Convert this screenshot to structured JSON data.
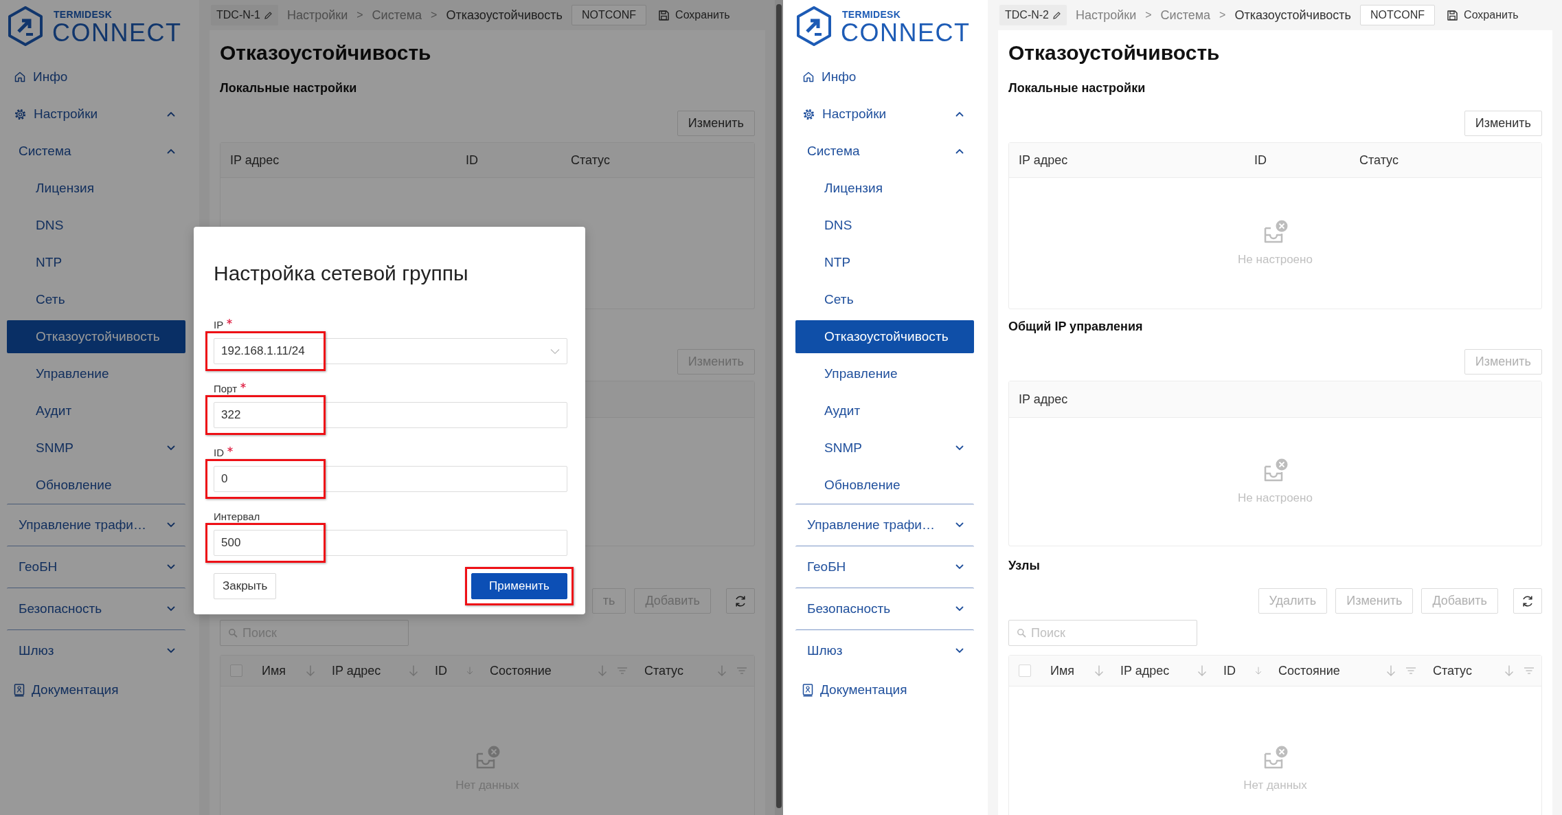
{
  "panes": [
    {
      "logo": {
        "brand": "TERMIDESK",
        "product": "CONNECT"
      },
      "node": "TDC-N-1",
      "breadcrumbs": [
        {
          "label": "Настройки",
          "separator": ">",
          "current": false
        },
        {
          "label": "Система",
          "separator": ">",
          "current": false
        },
        {
          "label": "Отказоустойчивость",
          "current": true
        }
      ],
      "mode": "NOTCONF",
      "save": "Сохранить",
      "sidebar": [
        {
          "kind": "home",
          "label": "Инфо",
          "selected": false
        },
        {
          "kind": "settings",
          "label": "Настройки",
          "selected": false,
          "expanded": true,
          "children": [
            {
              "kind": "group",
              "label": "Система",
              "selected": false,
              "expanded": true,
              "children": [
                {
                  "kind": "item",
                  "label": "Лицензия",
                  "selected": false
                },
                {
                  "kind": "item",
                  "label": "DNS",
                  "selected": false
                },
                {
                  "kind": "item",
                  "label": "NTP",
                  "selected": false
                },
                {
                  "kind": "item",
                  "label": "Сеть",
                  "selected": false
                },
                {
                  "kind": "item",
                  "label": "Отказоустойчивость",
                  "selected": true
                },
                {
                  "kind": "item",
                  "label": "Управление",
                  "selected": false
                },
                {
                  "kind": "item",
                  "label": "Аудит",
                  "selected": false
                },
                {
                  "kind": "group",
                  "label": "SNMP",
                  "selected": false,
                  "expanded": false
                },
                {
                  "kind": "item",
                  "label": "Обновление",
                  "selected": false
                }
              ]
            },
            {
              "kind": "group",
              "label": "Управление трафи…",
              "selected": false,
              "expanded": false
            },
            {
              "kind": "group",
              "label": "ГеоБН",
              "selected": false,
              "expanded": false
            },
            {
              "kind": "group",
              "label": "Безопасность",
              "selected": false,
              "expanded": false
            },
            {
              "kind": "group",
              "label": "Шлюз",
              "selected": false,
              "expanded": false
            }
          ]
        },
        {
          "kind": "docs",
          "label": "Документация",
          "selected": false
        }
      ],
      "page_title": "Отказоустойчивость",
      "sections": [
        {
          "title": "Локальные настройки",
          "buttons": [
            {
              "kind": "text",
              "label": "Изменить",
              "disabled": false
            }
          ],
          "table": {
            "columns": [
              {
                "label": "IP адрес"
              },
              {
                "label": "ID"
              },
              {
                "label": "Статус"
              }
            ]
          }
        },
        {
          "buttons": [
            {
              "kind": "text",
              "label": "Изменить",
              "disabled": true
            }
          ]
        },
        {
          "buttons": [
            {
              "kind": "text",
              "label": "ть",
              "disabled": true
            },
            {
              "kind": "text",
              "label": "Добавить",
              "disabled": true
            },
            {
              "kind": "refresh"
            }
          ],
          "search": {
            "placeholder": "Поиск"
          },
          "table": {
            "select_all": {
              "checked": false
            },
            "columns": [
              {
                "label": "Имя",
                "sortable": true,
                "filterable": false
              },
              {
                "label": "IP адрес",
                "sortable": true,
                "filterable": false
              },
              {
                "label": "ID",
                "sortable": true,
                "filterable": false
              },
              {
                "label": "Состояние",
                "sortable": true,
                "filterable": true
              },
              {
                "label": "Статус",
                "sortable": true,
                "filterable": true
              }
            ],
            "empty_text": "Нет данных"
          }
        }
      ],
      "dialog": {
        "title": "Настройка сетевой группы",
        "fields": [
          {
            "kind": "select",
            "label": "IP",
            "required": true,
            "value": "192.168.1.11/24",
            "highlighted": true
          },
          {
            "kind": "text",
            "label": "Порт",
            "required": true,
            "value": "322",
            "highlighted": true
          },
          {
            "kind": "text",
            "label": "ID",
            "required": true,
            "value": "0",
            "highlighted": true
          },
          {
            "kind": "text",
            "label": "Интервал",
            "required": false,
            "value": "500",
            "highlighted": true
          }
        ],
        "buttons": [
          {
            "kind": "secondary",
            "label": "Закрыть",
            "highlighted": false
          },
          {
            "kind": "primary",
            "label": "Применить",
            "highlighted": true
          }
        ]
      }
    },
    {
      "logo": {
        "brand": "TERMIDESK",
        "product": "CONNECT"
      },
      "node": "TDC-N-2",
      "breadcrumbs": [
        {
          "label": "Настройки",
          "separator": ">",
          "current": false
        },
        {
          "label": "Система",
          "separator": ">",
          "current": false
        },
        {
          "label": "Отказоустойчивость",
          "current": true
        }
      ],
      "mode": "NOTCONF",
      "save": "Сохранить",
      "sidebar": [
        {
          "kind": "home",
          "label": "Инфо",
          "selected": false
        },
        {
          "kind": "settings",
          "label": "Настройки",
          "selected": false,
          "expanded": true,
          "children": [
            {
              "kind": "group",
              "label": "Система",
              "selected": false,
              "expanded": true,
              "children": [
                {
                  "kind": "item",
                  "label": "Лицензия",
                  "selected": false
                },
                {
                  "kind": "item",
                  "label": "DNS",
                  "selected": false
                },
                {
                  "kind": "item",
                  "label": "NTP",
                  "selected": false
                },
                {
                  "kind": "item",
                  "label": "Сеть",
                  "selected": false
                },
                {
                  "kind": "item",
                  "label": "Отказоустойчивость",
                  "selected": true
                },
                {
                  "kind": "item",
                  "label": "Управление",
                  "selected": false
                },
                {
                  "kind": "item",
                  "label": "Аудит",
                  "selected": false
                },
                {
                  "kind": "group",
                  "label": "SNMP",
                  "selected": false,
                  "expanded": false
                },
                {
                  "kind": "item",
                  "label": "Обновление",
                  "selected": false
                }
              ]
            },
            {
              "kind": "group",
              "label": "Управление трафи…",
              "selected": false,
              "expanded": false
            },
            {
              "kind": "group",
              "label": "ГеоБН",
              "selected": false,
              "expanded": false
            },
            {
              "kind": "group",
              "label": "Безопасность",
              "selected": false,
              "expanded": false
            },
            {
              "kind": "group",
              "label": "Шлюз",
              "selected": false,
              "expanded": false
            }
          ]
        },
        {
          "kind": "docs",
          "label": "Документация",
          "selected": false
        }
      ],
      "page_title": "Отказоустойчивость",
      "sections": [
        {
          "title": "Локальные настройки",
          "buttons": [
            {
              "kind": "text",
              "label": "Изменить",
              "disabled": false
            }
          ],
          "table": {
            "columns": [
              {
                "label": "IP адрес"
              },
              {
                "label": "ID"
              },
              {
                "label": "Статус"
              }
            ],
            "empty_text": "Не настроено"
          }
        },
        {
          "title": "Общий IP управления",
          "buttons": [
            {
              "kind": "text",
              "label": "Изменить",
              "disabled": true
            }
          ],
          "table": {
            "columns": [
              {
                "label": "IP адрес"
              }
            ],
            "empty_text": "Не настроено"
          }
        },
        {
          "title": "Узлы",
          "buttons": [
            {
              "kind": "text",
              "label": "Удалить",
              "disabled": true
            },
            {
              "kind": "text",
              "label": "Изменить",
              "disabled": true
            },
            {
              "kind": "text",
              "label": "Добавить",
              "disabled": true
            },
            {
              "kind": "refresh"
            }
          ],
          "search": {
            "placeholder": "Поиск"
          },
          "table": {
            "select_all": {
              "checked": false
            },
            "columns": [
              {
                "label": "Имя",
                "sortable": true,
                "filterable": false
              },
              {
                "label": "IP адрес",
                "sortable": true,
                "filterable": false
              },
              {
                "label": "ID",
                "sortable": true,
                "filterable": false
              },
              {
                "label": "Состояние",
                "sortable": true,
                "filterable": true
              },
              {
                "label": "Статус",
                "sortable": true,
                "filterable": true
              }
            ],
            "empty_text": "Нет данных"
          }
        }
      ]
    }
  ]
}
